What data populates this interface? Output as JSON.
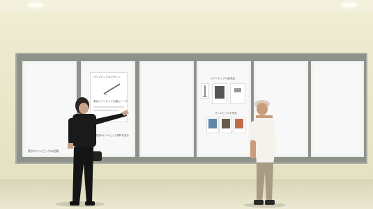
{
  "screens": {
    "panel2": {
      "title": "オリンピックのデザイン",
      "caption": "東京オリンピックの聖火トーチ",
      "footer": "前回のオリンピック資料を見る"
    },
    "panel4": {
      "title": "オリンピックの記念品",
      "section": "オリンピックの作品"
    },
    "panel1": {
      "footer": "東京オリンピックの記憶"
    }
  },
  "colors": {
    "wall": "#e8e6c8",
    "frame": "#8d9389",
    "screen": "#f7f8f7",
    "shirt_left": "#1a1a1a",
    "shirt_right": "#f4f2ea",
    "pants_right": "#a99a83"
  }
}
